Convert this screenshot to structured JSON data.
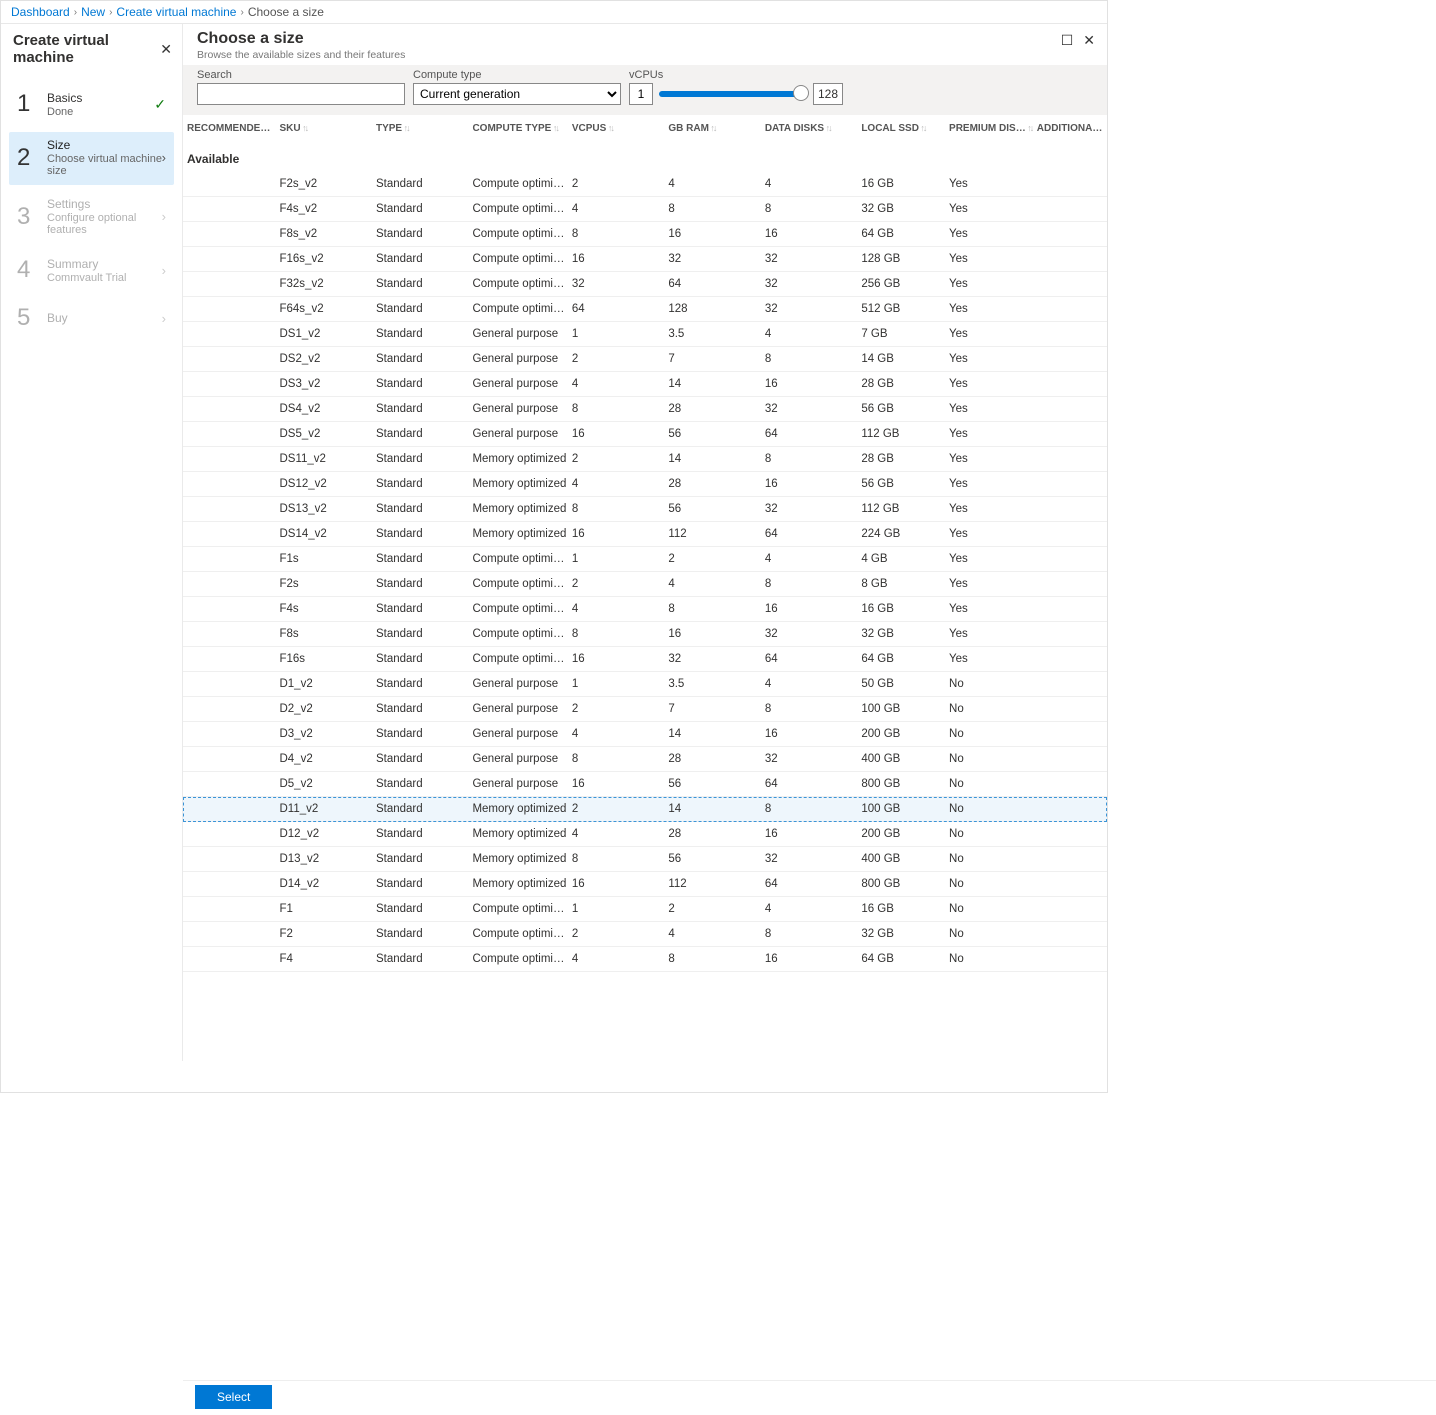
{
  "breadcrumb": {
    "items": [
      "Dashboard",
      "New",
      "Create virtual machine"
    ],
    "current": "Choose a size"
  },
  "left": {
    "title": "Create virtual machine",
    "steps": [
      {
        "num": "1",
        "title": "Basics",
        "sub": "Done",
        "state": "done"
      },
      {
        "num": "2",
        "title": "Size",
        "sub": "Choose virtual machine size",
        "state": "active"
      },
      {
        "num": "3",
        "title": "Settings",
        "sub": "Configure optional features",
        "state": "disabled"
      },
      {
        "num": "4",
        "title": "Summary",
        "sub": "Commvault Trial",
        "state": "disabled"
      },
      {
        "num": "5",
        "title": "Buy",
        "sub": "",
        "state": "disabled"
      }
    ]
  },
  "right": {
    "title": "Choose a size",
    "sub": "Browse the available sizes and their features"
  },
  "filters": {
    "search_label": "Search",
    "compute_label": "Compute type",
    "compute_value": "Current generation",
    "vcpu_label": "vCPUs",
    "vcpu_min": "1",
    "vcpu_max": "128"
  },
  "columns": [
    "RECOMMENDE…",
    "SKU",
    "TYPE",
    "COMPUTE TYPE",
    "VCPUS",
    "GB RAM",
    "DATA DISKS",
    "LOCAL SSD",
    "PREMIUM DIS…",
    "ADDITIONAL F…"
  ],
  "group_label": "Available",
  "selected_sku": "D11_v2",
  "rows": [
    {
      "sku": "F2s_v2",
      "type": "Standard",
      "ct": "Compute optimized",
      "vc": "2",
      "ram": "4",
      "dd": "4",
      "ssd": "16 GB",
      "prem": "Yes"
    },
    {
      "sku": "F4s_v2",
      "type": "Standard",
      "ct": "Compute optimized",
      "vc": "4",
      "ram": "8",
      "dd": "8",
      "ssd": "32 GB",
      "prem": "Yes"
    },
    {
      "sku": "F8s_v2",
      "type": "Standard",
      "ct": "Compute optimized",
      "vc": "8",
      "ram": "16",
      "dd": "16",
      "ssd": "64 GB",
      "prem": "Yes"
    },
    {
      "sku": "F16s_v2",
      "type": "Standard",
      "ct": "Compute optimized",
      "vc": "16",
      "ram": "32",
      "dd": "32",
      "ssd": "128 GB",
      "prem": "Yes"
    },
    {
      "sku": "F32s_v2",
      "type": "Standard",
      "ct": "Compute optimized",
      "vc": "32",
      "ram": "64",
      "dd": "32",
      "ssd": "256 GB",
      "prem": "Yes"
    },
    {
      "sku": "F64s_v2",
      "type": "Standard",
      "ct": "Compute optimized",
      "vc": "64",
      "ram": "128",
      "dd": "32",
      "ssd": "512 GB",
      "prem": "Yes"
    },
    {
      "sku": "DS1_v2",
      "type": "Standard",
      "ct": "General purpose",
      "vc": "1",
      "ram": "3.5",
      "dd": "4",
      "ssd": "7 GB",
      "prem": "Yes"
    },
    {
      "sku": "DS2_v2",
      "type": "Standard",
      "ct": "General purpose",
      "vc": "2",
      "ram": "7",
      "dd": "8",
      "ssd": "14 GB",
      "prem": "Yes"
    },
    {
      "sku": "DS3_v2",
      "type": "Standard",
      "ct": "General purpose",
      "vc": "4",
      "ram": "14",
      "dd": "16",
      "ssd": "28 GB",
      "prem": "Yes"
    },
    {
      "sku": "DS4_v2",
      "type": "Standard",
      "ct": "General purpose",
      "vc": "8",
      "ram": "28",
      "dd": "32",
      "ssd": "56 GB",
      "prem": "Yes"
    },
    {
      "sku": "DS5_v2",
      "type": "Standard",
      "ct": "General purpose",
      "vc": "16",
      "ram": "56",
      "dd": "64",
      "ssd": "112 GB",
      "prem": "Yes"
    },
    {
      "sku": "DS11_v2",
      "type": "Standard",
      "ct": "Memory optimized",
      "vc": "2",
      "ram": "14",
      "dd": "8",
      "ssd": "28 GB",
      "prem": "Yes"
    },
    {
      "sku": "DS12_v2",
      "type": "Standard",
      "ct": "Memory optimized",
      "vc": "4",
      "ram": "28",
      "dd": "16",
      "ssd": "56 GB",
      "prem": "Yes"
    },
    {
      "sku": "DS13_v2",
      "type": "Standard",
      "ct": "Memory optimized",
      "vc": "8",
      "ram": "56",
      "dd": "32",
      "ssd": "112 GB",
      "prem": "Yes"
    },
    {
      "sku": "DS14_v2",
      "type": "Standard",
      "ct": "Memory optimized",
      "vc": "16",
      "ram": "112",
      "dd": "64",
      "ssd": "224 GB",
      "prem": "Yes"
    },
    {
      "sku": "F1s",
      "type": "Standard",
      "ct": "Compute optimized",
      "vc": "1",
      "ram": "2",
      "dd": "4",
      "ssd": "4 GB",
      "prem": "Yes"
    },
    {
      "sku": "F2s",
      "type": "Standard",
      "ct": "Compute optimized",
      "vc": "2",
      "ram": "4",
      "dd": "8",
      "ssd": "8 GB",
      "prem": "Yes"
    },
    {
      "sku": "F4s",
      "type": "Standard",
      "ct": "Compute optimized",
      "vc": "4",
      "ram": "8",
      "dd": "16",
      "ssd": "16 GB",
      "prem": "Yes"
    },
    {
      "sku": "F8s",
      "type": "Standard",
      "ct": "Compute optimized",
      "vc": "8",
      "ram": "16",
      "dd": "32",
      "ssd": "32 GB",
      "prem": "Yes"
    },
    {
      "sku": "F16s",
      "type": "Standard",
      "ct": "Compute optimized",
      "vc": "16",
      "ram": "32",
      "dd": "64",
      "ssd": "64 GB",
      "prem": "Yes"
    },
    {
      "sku": "D1_v2",
      "type": "Standard",
      "ct": "General purpose",
      "vc": "1",
      "ram": "3.5",
      "dd": "4",
      "ssd": "50 GB",
      "prem": "No"
    },
    {
      "sku": "D2_v2",
      "type": "Standard",
      "ct": "General purpose",
      "vc": "2",
      "ram": "7",
      "dd": "8",
      "ssd": "100 GB",
      "prem": "No"
    },
    {
      "sku": "D3_v2",
      "type": "Standard",
      "ct": "General purpose",
      "vc": "4",
      "ram": "14",
      "dd": "16",
      "ssd": "200 GB",
      "prem": "No"
    },
    {
      "sku": "D4_v2",
      "type": "Standard",
      "ct": "General purpose",
      "vc": "8",
      "ram": "28",
      "dd": "32",
      "ssd": "400 GB",
      "prem": "No"
    },
    {
      "sku": "D5_v2",
      "type": "Standard",
      "ct": "General purpose",
      "vc": "16",
      "ram": "56",
      "dd": "64",
      "ssd": "800 GB",
      "prem": "No"
    },
    {
      "sku": "D11_v2",
      "type": "Standard",
      "ct": "Memory optimized",
      "vc": "2",
      "ram": "14",
      "dd": "8",
      "ssd": "100 GB",
      "prem": "No"
    },
    {
      "sku": "D12_v2",
      "type": "Standard",
      "ct": "Memory optimized",
      "vc": "4",
      "ram": "28",
      "dd": "16",
      "ssd": "200 GB",
      "prem": "No"
    },
    {
      "sku": "D13_v2",
      "type": "Standard",
      "ct": "Memory optimized",
      "vc": "8",
      "ram": "56",
      "dd": "32",
      "ssd": "400 GB",
      "prem": "No"
    },
    {
      "sku": "D14_v2",
      "type": "Standard",
      "ct": "Memory optimized",
      "vc": "16",
      "ram": "112",
      "dd": "64",
      "ssd": "800 GB",
      "prem": "No"
    },
    {
      "sku": "F1",
      "type": "Standard",
      "ct": "Compute optimized",
      "vc": "1",
      "ram": "2",
      "dd": "4",
      "ssd": "16 GB",
      "prem": "No"
    },
    {
      "sku": "F2",
      "type": "Standard",
      "ct": "Compute optimized",
      "vc": "2",
      "ram": "4",
      "dd": "8",
      "ssd": "32 GB",
      "prem": "No"
    },
    {
      "sku": "F4",
      "type": "Standard",
      "ct": "Compute optimized",
      "vc": "4",
      "ram": "8",
      "dd": "16",
      "ssd": "64 GB",
      "prem": "No"
    }
  ],
  "footer": {
    "select_label": "Select"
  }
}
